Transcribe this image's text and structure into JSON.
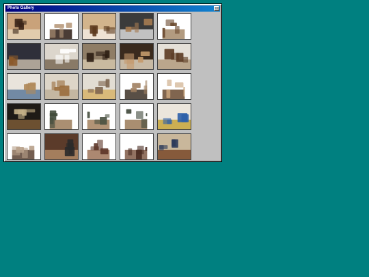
{
  "window": {
    "title": "Photo Gallery",
    "button_glyph": "□"
  },
  "thumbnails": [
    {
      "name": "pipe-on-desk",
      "palette": [
        "#c9a27a",
        "#3a2418",
        "#e6d3b6"
      ]
    },
    {
      "name": "pipe-in-box-1",
      "palette": [
        "#ffffff",
        "#b89a7c",
        "#2a1a12"
      ]
    },
    {
      "name": "pipe-in-box-2",
      "palette": [
        "#d2b48c",
        "#5c3a1e",
        "#f3eadf"
      ]
    },
    {
      "name": "pipe-display-case",
      "palette": [
        "#3b3b3b",
        "#a67c52",
        "#d9d9d9"
      ]
    },
    {
      "name": "pipe-cabinet",
      "palette": [
        "#ffffff",
        "#6b4a2f",
        "#a58a6a"
      ]
    },
    {
      "name": "pipe-rack-wall",
      "palette": [
        "#2f2f3a",
        "#8b5a2b",
        "#c3b7a8"
      ]
    },
    {
      "name": "framed-pipe-art",
      "palette": [
        "#dcd6cc",
        "#ffffff",
        "#7a6a55"
      ]
    },
    {
      "name": "pipe-stands-shelf",
      "palette": [
        "#8f7d66",
        "#2b1d12",
        "#d4c4aa"
      ]
    },
    {
      "name": "pipe-collection-table",
      "palette": [
        "#3a2a1e",
        "#c49a6c",
        "#e1d2bc"
      ]
    },
    {
      "name": "pipe-row-shelf",
      "palette": [
        "#e5e0d8",
        "#5a3a22",
        "#b39b7f"
      ]
    },
    {
      "name": "tobacco-tins-1",
      "palette": [
        "#e9e4dc",
        "#b08a5a",
        "#5d7a9a"
      ]
    },
    {
      "name": "tobacco-tins-2",
      "palette": [
        "#ddd5c8",
        "#9a6d3c",
        "#c0b29a"
      ]
    },
    {
      "name": "tobacco-tins-3",
      "palette": [
        "#e2ddd3",
        "#7e6650",
        "#d7b46a"
      ]
    },
    {
      "name": "floor-lamp-room",
      "palette": [
        "#ffffff",
        "#a08060",
        "#3c3026"
      ]
    },
    {
      "name": "bookshelf-pipes",
      "palette": [
        "#ffffff",
        "#c7a27a",
        "#6a4a30"
      ]
    },
    {
      "name": "jars-on-shelves",
      "palette": [
        "#1e1a16",
        "#c8b48a",
        "#7a5a36"
      ]
    },
    {
      "name": "pipe-carousel-1",
      "palette": [
        "#ffffff",
        "#3f4a3a",
        "#9b7b59"
      ]
    },
    {
      "name": "pipe-carousel-2",
      "palette": [
        "#ffffff",
        "#485040",
        "#a4815e"
      ]
    },
    {
      "name": "pipe-carousel-3",
      "palette": [
        "#ffffff",
        "#3e4638",
        "#9a7a58"
      ]
    },
    {
      "name": "colorful-tins-stack",
      "palette": [
        "#ece6dc",
        "#2d5fa8",
        "#c7a53a"
      ]
    },
    {
      "name": "pipe-box-open",
      "palette": [
        "#ffffff",
        "#b7a089",
        "#5a4232"
      ]
    },
    {
      "name": "pipes-in-drawer",
      "palette": [
        "#5b3b2a",
        "#2a2a2a",
        "#b18b66"
      ]
    },
    {
      "name": "carved-pipe-bowl-1",
      "palette": [
        "#ffffff",
        "#5c3528",
        "#9d7358"
      ]
    },
    {
      "name": "carved-pipe-bowl-2",
      "palette": [
        "#ffffff",
        "#4a2c22",
        "#7f5b46"
      ]
    },
    {
      "name": "pipe-on-cloth",
      "palette": [
        "#c9b79b",
        "#2c3a5a",
        "#7a4a2a"
      ]
    }
  ]
}
